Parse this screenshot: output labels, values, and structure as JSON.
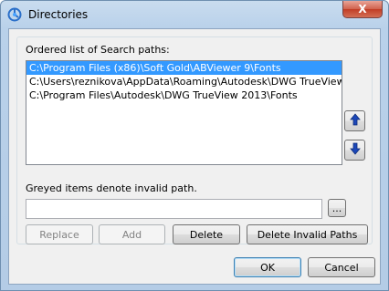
{
  "window": {
    "title": "Directories",
    "close_symbol": "X"
  },
  "search_paths": {
    "label": "Ordered list of Search paths:",
    "items": [
      "C:\\Program Files (x86)\\Soft Gold\\ABViewer 9\\Fonts",
      "C:\\Users\\reznikova\\AppData\\Roaming\\Autodesk\\DWG TrueView",
      "C:\\Program Files\\Autodesk\\DWG TrueView 2013\\Fonts"
    ],
    "selected_index": 0
  },
  "hint": "Greyed items denote invalid path.",
  "path_input": {
    "value": ""
  },
  "buttons": {
    "browse": "...",
    "replace": "Replace",
    "add": "Add",
    "delete": "Delete",
    "delete_invalid": "Delete Invalid Paths",
    "ok": "OK",
    "cancel": "Cancel"
  },
  "icons": {
    "app": "directories-app-icon",
    "move_up": "arrow-up-icon",
    "move_down": "arrow-down-icon"
  },
  "colors": {
    "selection": "#3399ff",
    "arrow": "#1c47b8"
  }
}
